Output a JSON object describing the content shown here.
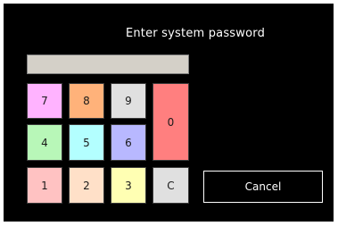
{
  "dialog": {
    "title": "Enter system password",
    "password_value": ""
  },
  "keypad": {
    "keys": [
      {
        "label": "7",
        "color": "#ffb3ff"
      },
      {
        "label": "8",
        "color": "#ffb27a"
      },
      {
        "label": "9",
        "color": "#e0e0e0"
      },
      {
        "label": "0",
        "color": "#ff7f7f"
      },
      {
        "label": "4",
        "color": "#b8f7b8"
      },
      {
        "label": "5",
        "color": "#b3ffff"
      },
      {
        "label": "6",
        "color": "#b8b8ff"
      },
      {
        "label": "1",
        "color": "#ffc2c2"
      },
      {
        "label": "2",
        "color": "#ffe0c8"
      },
      {
        "label": "3",
        "color": "#ffffb3"
      },
      {
        "label": "C",
        "color": "#e0e0e0"
      }
    ]
  },
  "buttons": {
    "cancel_label": "Cancel"
  }
}
